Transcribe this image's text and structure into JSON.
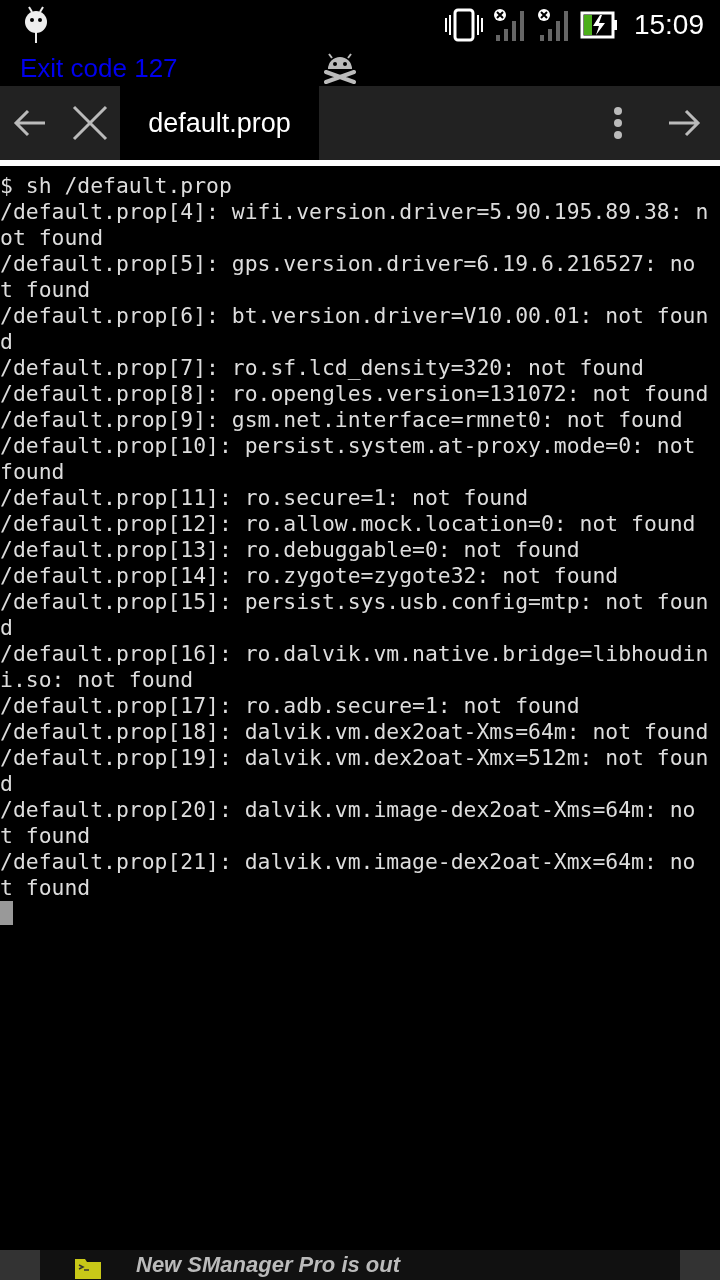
{
  "status_bar": {
    "time": "15:09"
  },
  "header": {
    "status_text": "Exit code 127"
  },
  "tabs": [
    {
      "label": "default.prop",
      "selected": true
    }
  ],
  "terminal": {
    "lines": [
      "$ sh /default.prop",
      "/default.prop[4]: wifi.version.driver=5.90.195.89.38: not found",
      "/default.prop[5]: gps.version.driver=6.19.6.216527: not found",
      "/default.prop[6]: bt.version.driver=V10.00.01: not found",
      "/default.prop[7]: ro.sf.lcd_density=320: not found",
      "/default.prop[8]: ro.opengles.version=131072: not found",
      "/default.prop[9]: gsm.net.interface=rmnet0: not found",
      "/default.prop[10]: persist.system.at-proxy.mode=0: not found",
      "/default.prop[11]: ro.secure=1: not found",
      "/default.prop[12]: ro.allow.mock.location=0: not found",
      "/default.prop[13]: ro.debuggable=0: not found",
      "/default.prop[14]: ro.zygote=zygote32: not found",
      "/default.prop[15]: persist.sys.usb.config=mtp: not found",
      "/default.prop[16]: ro.dalvik.vm.native.bridge=libhoudini.so: not found",
      "/default.prop[17]: ro.adb.secure=1: not found",
      "/default.prop[18]: dalvik.vm.dex2oat-Xms=64m: not found",
      "/default.prop[19]: dalvik.vm.dex2oat-Xmx=512m: not found",
      "/default.prop[20]: dalvik.vm.image-dex2oat-Xms=64m: not found",
      "/default.prop[21]: dalvik.vm.image-dex2oat-Xmx=64m: not found"
    ]
  },
  "banner": {
    "text": "New SManager Pro is out"
  }
}
